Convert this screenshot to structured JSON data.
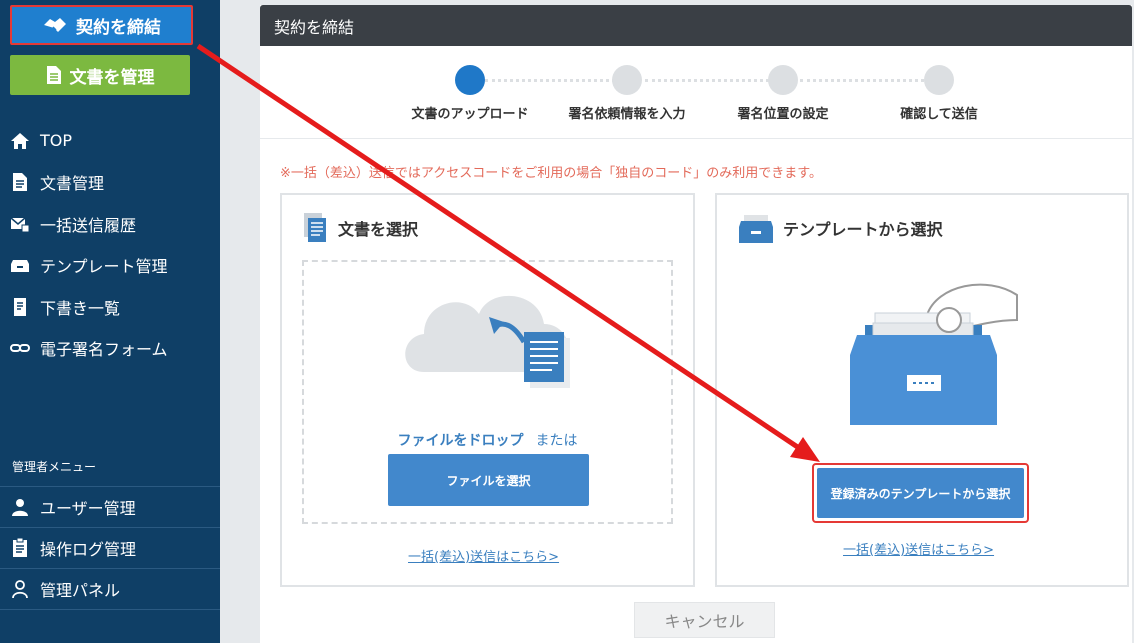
{
  "sidebar": {
    "contract_button": "契約を締結",
    "docs_button": "文書を管理",
    "items": [
      {
        "label": "TOP",
        "icon": "home-icon"
      },
      {
        "label": "文書管理",
        "icon": "document-icon"
      },
      {
        "label": "一括送信履歴",
        "icon": "bulk-send-icon"
      },
      {
        "label": "テンプレート管理",
        "icon": "template-box-icon"
      },
      {
        "label": "下書き一覧",
        "icon": "draft-icon"
      },
      {
        "label": "電子署名フォーム",
        "icon": "link-icon"
      }
    ],
    "admin_title": "管理者メニュー",
    "admin_items": [
      {
        "label": "ユーザー管理",
        "icon": "user-icon"
      },
      {
        "label": "操作ログ管理",
        "icon": "log-icon"
      },
      {
        "label": "管理パネル",
        "icon": "admin-panel-icon"
      }
    ]
  },
  "panel": {
    "title": "契約を締結",
    "steps": [
      {
        "label": "文書のアップロード",
        "active": true
      },
      {
        "label": "署名依頼情報を入力",
        "active": false
      },
      {
        "label": "署名位置の設定",
        "active": false
      },
      {
        "label": "確認して送信",
        "active": false
      }
    ],
    "notice": "※一括（差込）送信ではアクセスコードをご利用の場合「独自のコード」のみ利用できます。",
    "left_card": {
      "title": "文書を選択",
      "drop_text": "ファイルをドロップ",
      "or_text": "または",
      "select_button": "ファイルを選択",
      "bulk_link": "一括(差込)送信はこちら>"
    },
    "right_card": {
      "title": "テンプレートから選択",
      "template_button": "登録済みのテンプレートから選択",
      "bulk_link": "一括(差込)送信はこちら>"
    },
    "cancel_button": "キャンセル"
  },
  "colors": {
    "sidebar_bg": "#0f3f66",
    "primary": "#1f78c8",
    "green": "#7cb940",
    "highlight_red": "#e53935",
    "notice": "#e36a5a"
  }
}
